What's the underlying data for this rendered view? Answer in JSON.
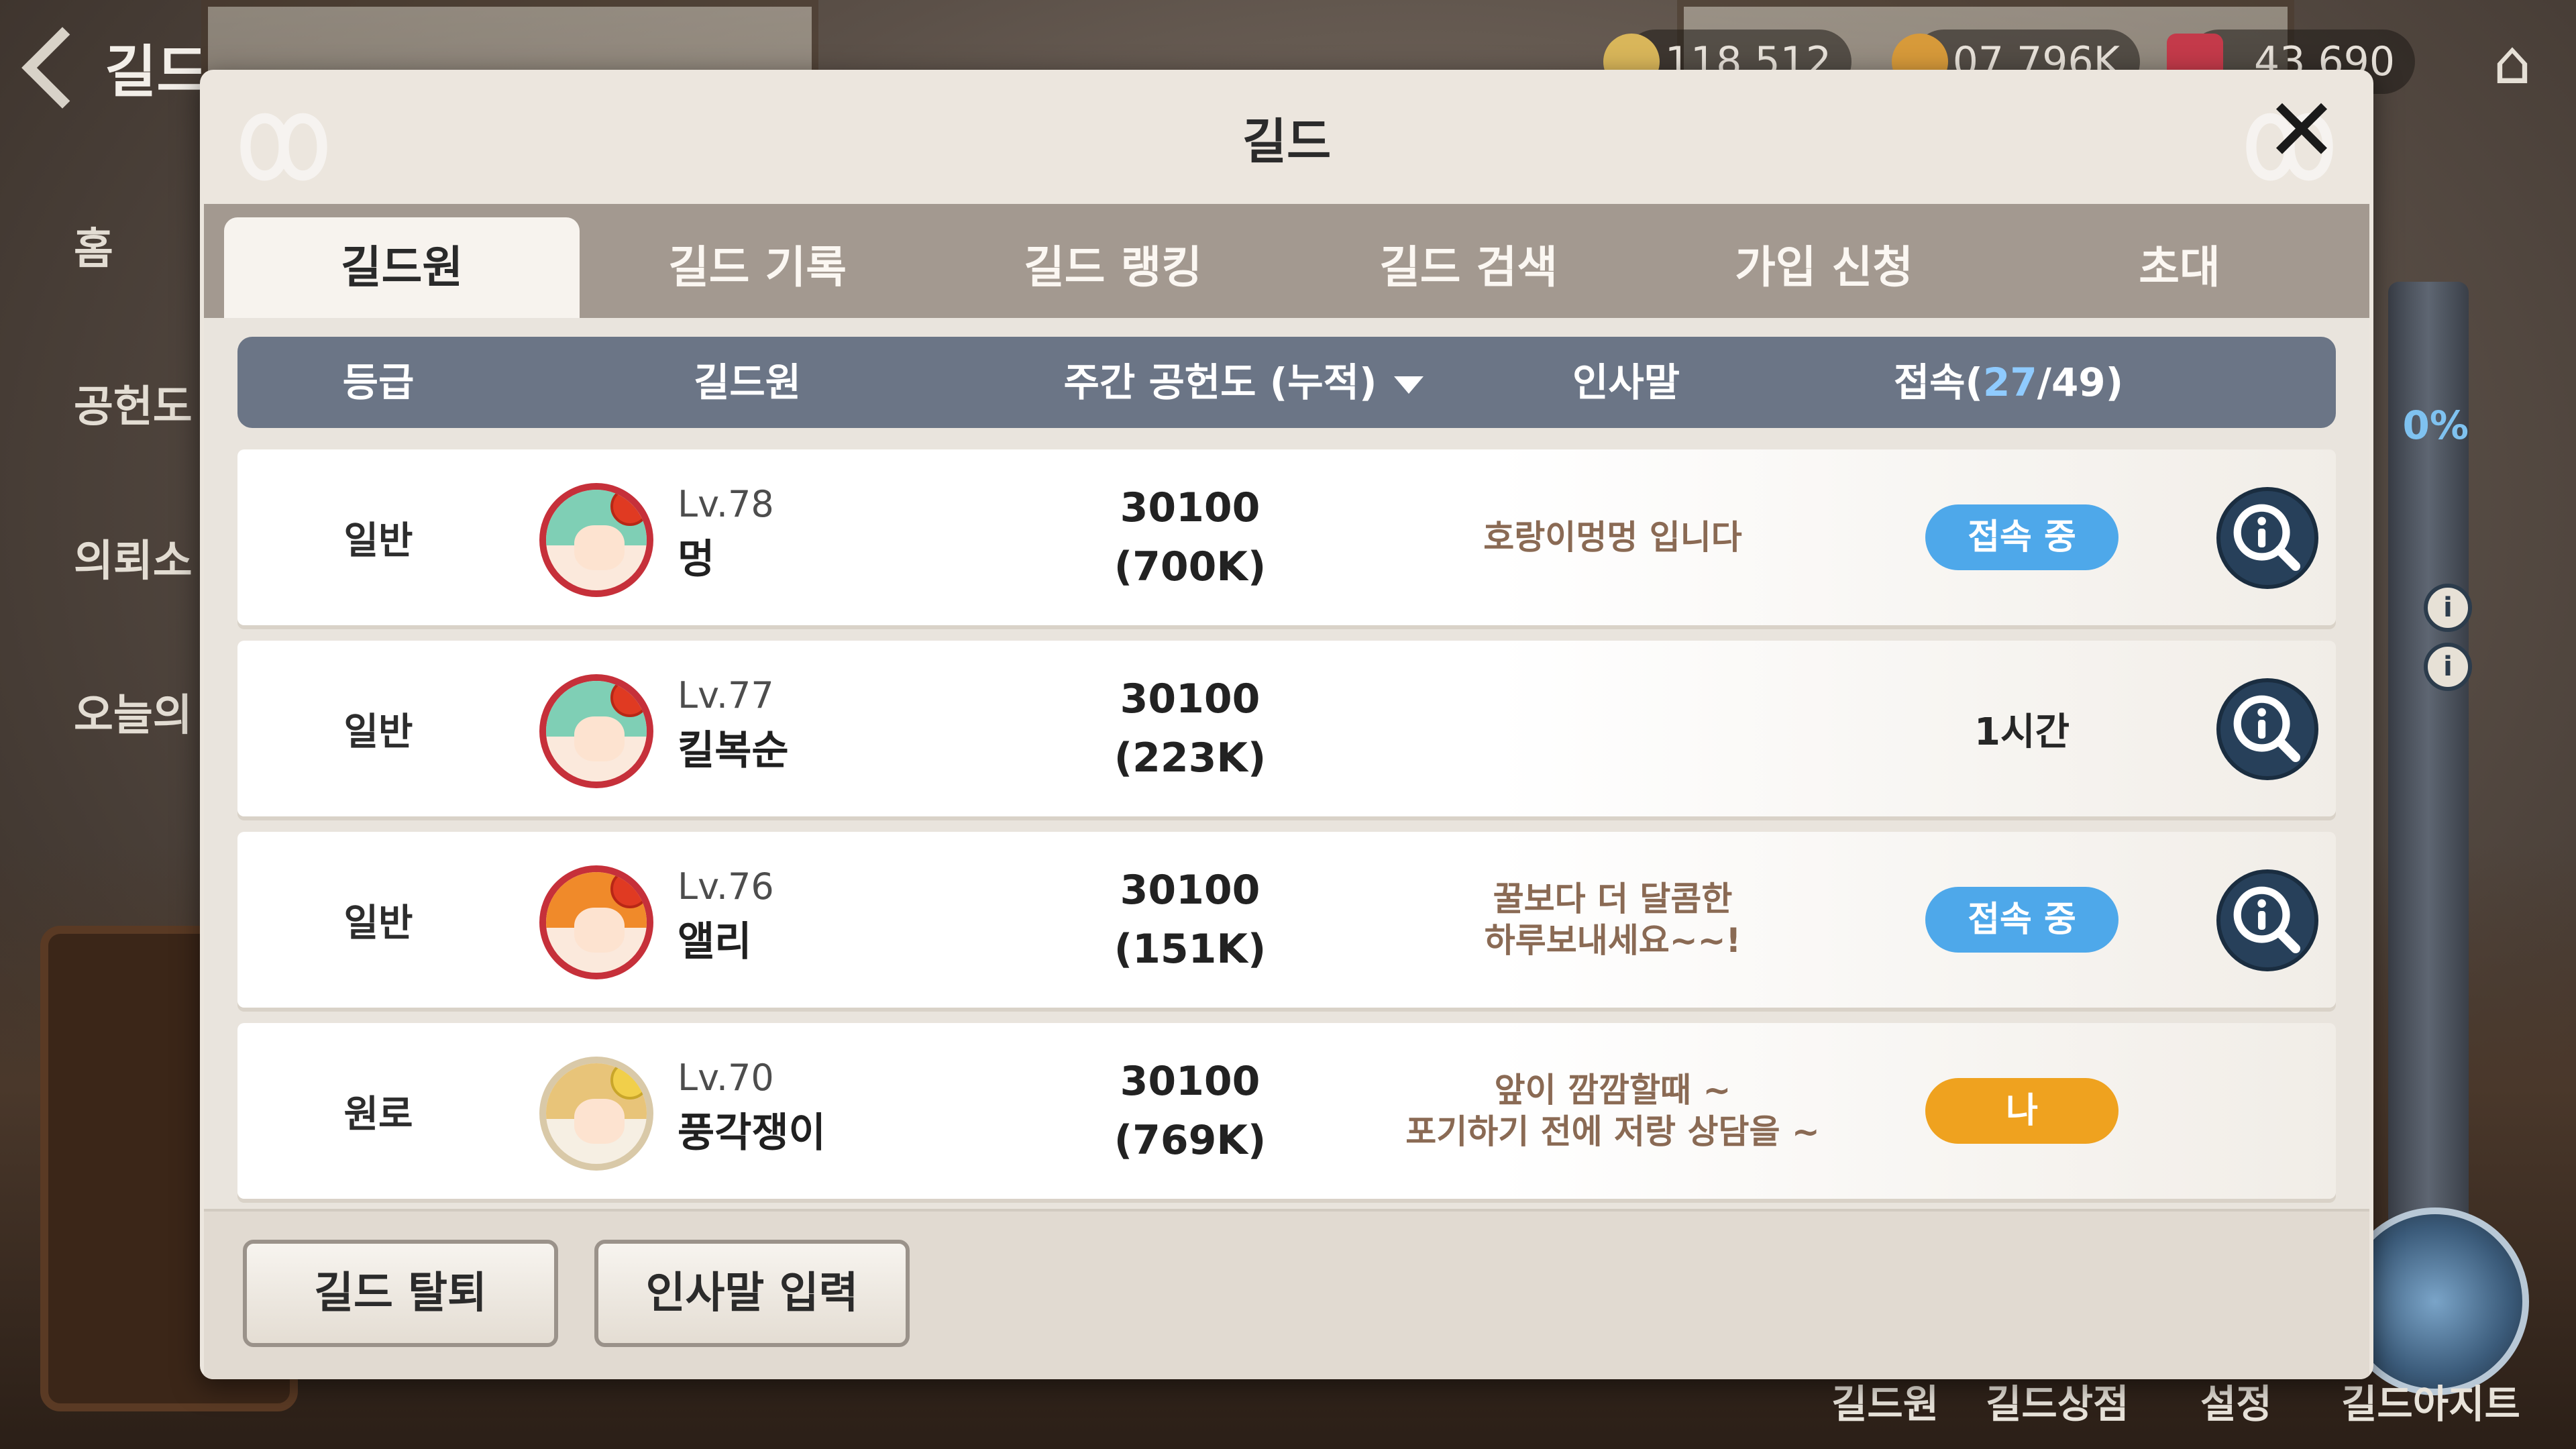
{
  "hud": {
    "back_label": "길드",
    "resources": [
      "118,512",
      "107,796K",
      "43,690"
    ],
    "side_menu": [
      "홈",
      "공헌도",
      "의뢰소",
      "오늘의"
    ],
    "bottom_menu": [
      "길드원",
      "길드상점",
      "설정",
      "길드아지트"
    ],
    "side_percent": "0%"
  },
  "modal": {
    "title": "길드",
    "close_icon": "close-icon",
    "tabs": [
      "길드원",
      "길드 기록",
      "길드 랭킹",
      "길드 검색",
      "가입 신청",
      "초대"
    ],
    "active_tab": 0
  },
  "table": {
    "headers": {
      "grade": "등급",
      "member": "길드원",
      "contribution": "주간 공헌도 (누적)",
      "greeting": "인사말",
      "access_prefix": "접속(",
      "access_online": "27",
      "access_suffix": "/49)"
    },
    "rows": [
      {
        "grade": "일반",
        "level": "Lv.78",
        "name": "멍",
        "weekly": "30100",
        "total": "(700K)",
        "greeting": "호랑이멍멍 입니다",
        "status": "접속 중",
        "status_type": "online",
        "avatar_hair": "#7fcfb5"
      },
      {
        "grade": "일반",
        "level": "Lv.77",
        "name": "킬복순",
        "weekly": "30100",
        "total": "(223K)",
        "greeting": "",
        "status": "1시간",
        "status_type": "text",
        "avatar_hair": "#7fcfb5"
      },
      {
        "grade": "일반",
        "level": "Lv.76",
        "name": "앨리",
        "weekly": "30100",
        "total": "(151K)",
        "greeting": "꿀보다 더 달콤한\n하루보내세요~~!",
        "status": "접속 중",
        "status_type": "online",
        "avatar_hair": "#f08a2a"
      },
      {
        "grade": "원로",
        "level": "Lv.70",
        "name": "풍각쟁이",
        "weekly": "30100",
        "total": "(769K)",
        "greeting": "앞이 깜깜할때 ~\n포기하기 전에 저랑 상담을 ~",
        "status": "나",
        "status_type": "me",
        "avatar_hair": "#e8c479"
      }
    ]
  },
  "footer": {
    "leave_label": "길드 탈퇴",
    "greeting_label": "인사말 입력"
  },
  "colors": {
    "online": "#4ea8ea",
    "me": "#efa21f",
    "header_bg": "#6b7586",
    "tabbar_bg": "#a39990"
  }
}
